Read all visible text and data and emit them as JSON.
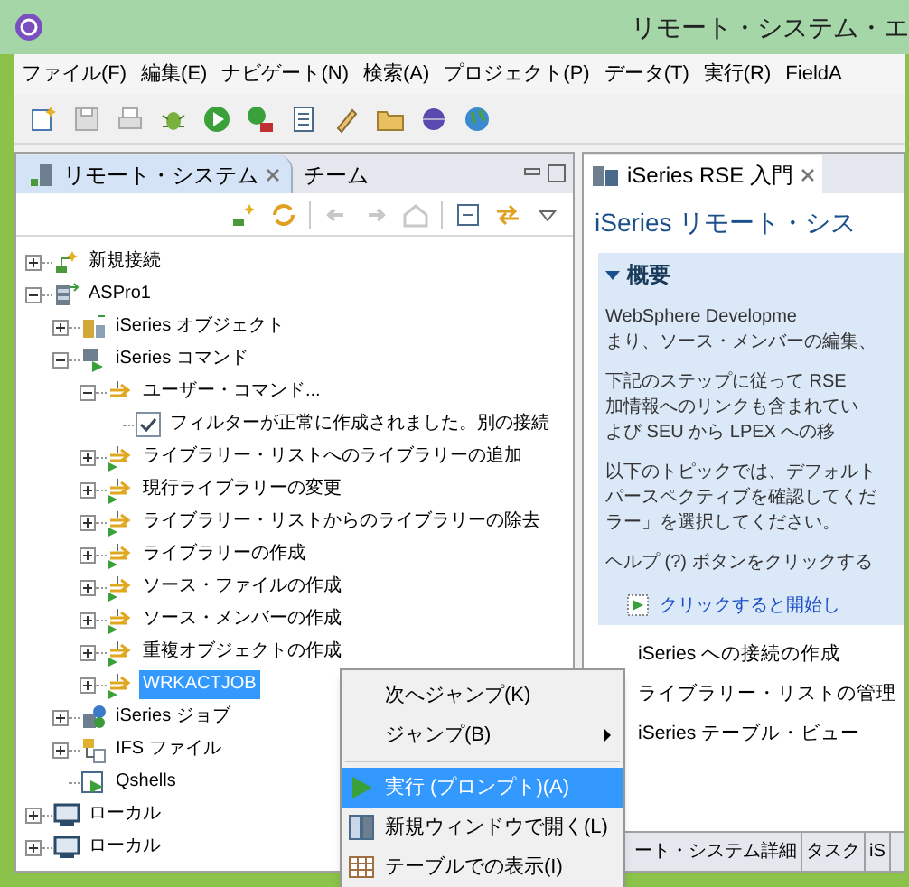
{
  "window": {
    "title": "リモート・システム・エ"
  },
  "menu": [
    "ファイル(F)",
    "編集(E)",
    "ナビゲート(N)",
    "検索(A)",
    "プロジェクト(P)",
    "データ(T)",
    "実行(R)",
    "FieldA"
  ],
  "left_panel": {
    "tabs": [
      {
        "label": "リモート・システム",
        "selected": true
      },
      {
        "label": "チーム",
        "selected": false
      }
    ],
    "tree": [
      {
        "label": "新規接続",
        "kind": "connection",
        "expanded": false
      },
      {
        "label": "ASPro1",
        "kind": "system",
        "expanded": true,
        "children": [
          {
            "label": "iSeries オブジェクト",
            "kind": "objects",
            "expanded": false
          },
          {
            "label": "iSeries コマンド",
            "kind": "commands",
            "expanded": true,
            "children": [
              {
                "label": "ユーザー・コマンド...",
                "kind": "folder",
                "expanded": true,
                "children": [
                  {
                    "label": "フィルターが正常に作成されました。別の接続",
                    "kind": "check"
                  }
                ]
              },
              {
                "label": "ライブラリー・リストへのライブラリーの追加",
                "kind": "command",
                "expanded": false,
                "selected": false
              },
              {
                "label": "現行ライブラリーの変更",
                "kind": "command",
                "expanded": false,
                "selected": false
              },
              {
                "label": "ライブラリー・リストからのライブラリーの除去",
                "kind": "command",
                "expanded": false,
                "selected": false
              },
              {
                "label": "ライブラリーの作成",
                "kind": "command",
                "expanded": false,
                "selected": false
              },
              {
                "label": "ソース・ファイルの作成",
                "kind": "command",
                "expanded": false,
                "selected": false
              },
              {
                "label": "ソース・メンバーの作成",
                "kind": "command",
                "expanded": false,
                "selected": false
              },
              {
                "label": "重複オブジェクトの作成",
                "kind": "command",
                "expanded": false,
                "selected": false
              },
              {
                "label": "WRKACTJOB",
                "kind": "command",
                "expanded": false,
                "selected": true
              }
            ]
          },
          {
            "label": "iSeries ジョブ",
            "kind": "jobs",
            "expanded": false
          },
          {
            "label": "IFS ファイル",
            "kind": "ifs",
            "expanded": false
          },
          {
            "label": "Qshells",
            "kind": "shell"
          }
        ]
      },
      {
        "label": "ローカル",
        "kind": "local",
        "expanded": false
      },
      {
        "label": "ローカル",
        "kind": "local",
        "expanded": false
      }
    ]
  },
  "right_panel": {
    "tab": "iSeries RSE 入門",
    "heading": "iSeries リモート・シス",
    "section": {
      "title": "概要",
      "expanded": true,
      "paragraphs": [
        [
          "WebSphere Developme",
          "まり、ソース・メンバーの編集、"
        ],
        [
          "下記のステップに従って RSE",
          "加情報へのリンクも含まれてい",
          "よび SEU から LPEX への移"
        ],
        [
          "以下のトピックでは、デフォルト",
          "パースペクティブを確認してくだ",
          "ラー」を選択してください。"
        ],
        [
          "ヘルプ (?) ボタンをクリックする"
        ]
      ],
      "link": "クリックすると開始し"
    },
    "topics": [
      "iSeries への接続の作成",
      "ライブラリー・リストの管理",
      "iSeries テーブル・ビュー"
    ]
  },
  "bottom_tabs": [
    "ート・システム詳細",
    "タスク",
    "iS"
  ],
  "context_menu": [
    {
      "kind": "plain",
      "label": "次へジャンプ(K)",
      "selected": false
    },
    {
      "kind": "submenu",
      "label": "ジャンプ(B)",
      "selected": false
    },
    {
      "kind": "separator"
    },
    {
      "kind": "run",
      "label": "実行 (プロンプト)(A)",
      "selected": true
    },
    {
      "kind": "new-window",
      "label": "新規ウィンドウで開く(L)",
      "selected": false
    },
    {
      "kind": "table",
      "label": "テーブルでの表示(I)",
      "selected": false
    }
  ]
}
